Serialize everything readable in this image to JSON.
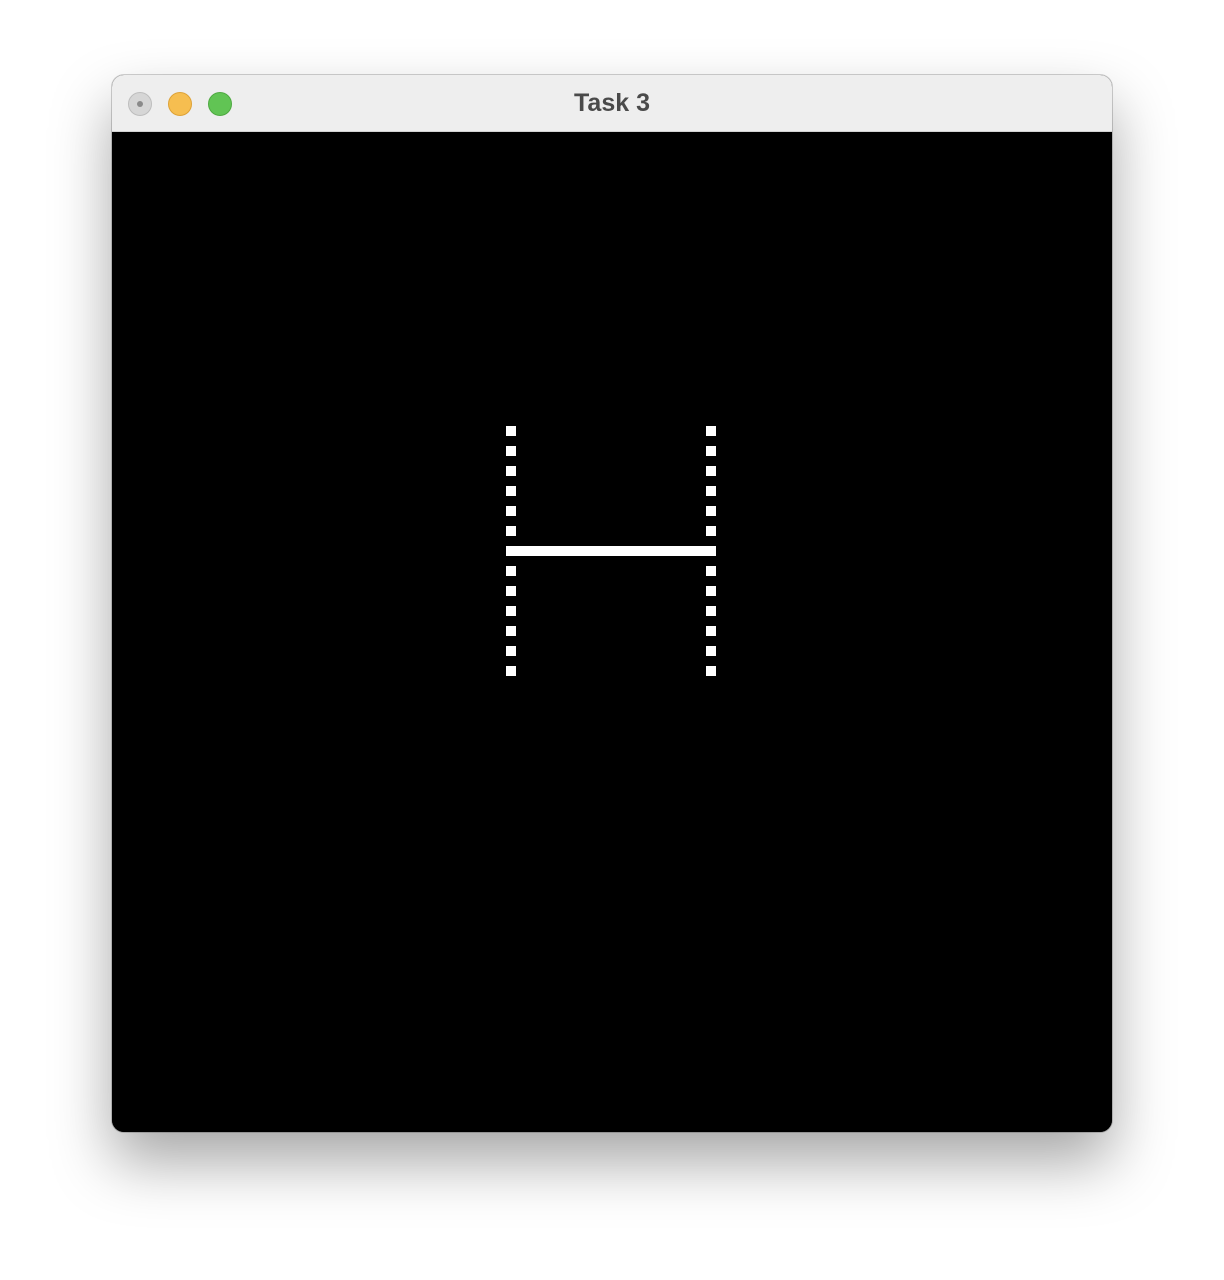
{
  "window": {
    "title": "Task 3"
  },
  "controls": {
    "close": "close-icon",
    "minimize": "minimize-icon",
    "maximize": "maximize-icon"
  },
  "canvas": {
    "background": "#000000",
    "foreground": "#ffffff",
    "glyph": "H",
    "dots_per_column": 13
  }
}
